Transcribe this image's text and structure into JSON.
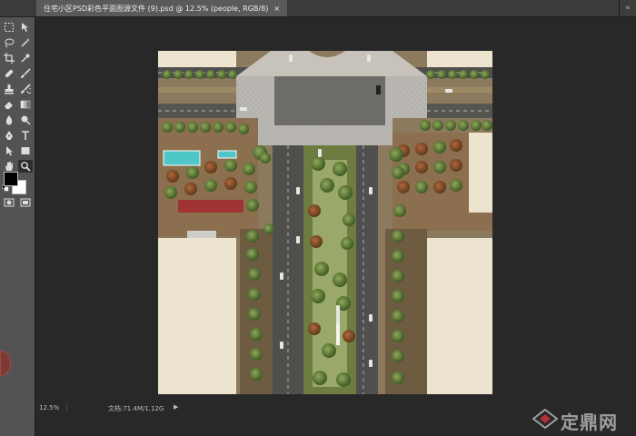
{
  "document_tab": {
    "title": "住宅小区PSD彩色平面图源文件 (9).psd @ 12.5% (people, RGB/8)",
    "close_glyph": "×"
  },
  "panel_collapse_glyph": "«",
  "tools": [
    "move-tool",
    "rect-marquee-tool",
    "lasso-tool",
    "magic-wand-tool",
    "crop-tool",
    "eyedropper-tool",
    "healing-brush-tool",
    "brush-tool",
    "clone-stamp-tool",
    "history-brush-tool",
    "eraser-tool",
    "gradient-tool",
    "blur-tool",
    "dodge-tool",
    "pen-tool",
    "type-tool",
    "path-select-tool",
    "shape-tool",
    "hand-tool",
    "zoom-tool"
  ],
  "active_tool": "zoom-tool",
  "colors": {
    "foreground": "#000000",
    "background": "#ffffff",
    "ui_dark": "#282828",
    "toolbar": "#535353",
    "tab_active": "#5a5a5a"
  },
  "status": {
    "zoom": "12.5%",
    "doc_size": "文档:71.4M/1.12G",
    "arrow": "▶"
  },
  "watermark": {
    "text": "定鼎网"
  },
  "canvas": {
    "description_icon": "landscape-site-plan-image"
  }
}
